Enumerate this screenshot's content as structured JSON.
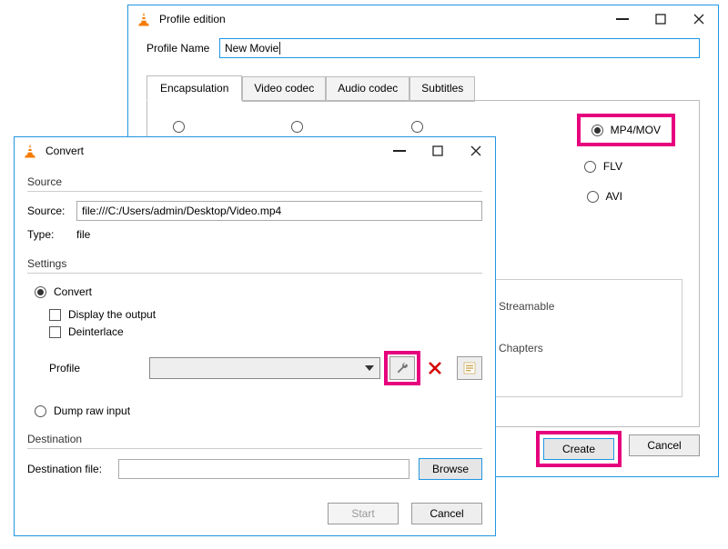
{
  "profile": {
    "title": "Profile edition",
    "name_label": "Profile Name",
    "name_value": "New Movie",
    "tabs": [
      "Encapsulation",
      "Video codec",
      "Audio codec",
      "Subtitles"
    ],
    "radios": {
      "mp4": "MP4/MOV",
      "flv": "FLV",
      "avi": "AVI"
    },
    "features": {
      "streamable": "Streamable",
      "chapters": "Chapters"
    },
    "create": "Create",
    "cancel": "Cancel"
  },
  "convert": {
    "title": "Convert",
    "source_group": "Source",
    "source_label": "Source:",
    "source_value": "file:///C:/Users/admin/Desktop/Video.mp4",
    "type_label": "Type:",
    "type_value": "file",
    "settings_group": "Settings",
    "convert_radio": "Convert",
    "display_output": "Display the output",
    "deinterlace": "Deinterlace",
    "profile_label": "Profile",
    "dump_radio": "Dump raw input",
    "destination_group": "Destination",
    "dest_file_label": "Destination file:",
    "browse": "Browse",
    "start": "Start",
    "cancel": "Cancel"
  }
}
